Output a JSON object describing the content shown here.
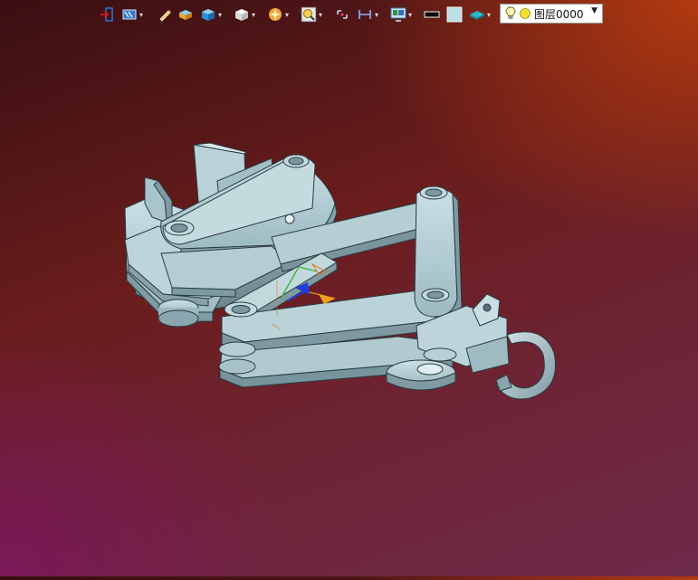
{
  "toolbar": {
    "layer": {
      "name": "图层0000",
      "icons": [
        "lightbulb-icon",
        "sun-icon"
      ]
    },
    "buttons": [
      "exit-icon",
      "film-icon",
      "pencil-icon",
      "box-solid-icon",
      "box-blue-icon",
      "cube-view-icon",
      "star-render-icon",
      "zoom-icon",
      "snap-icon",
      "dimension-icon",
      "display-icon",
      "line-color-icon",
      "fill-color-icon",
      "plane-icon"
    ]
  },
  "colors": {
    "part": "#b7d3d9",
    "part_shadow": "#7d9aa2",
    "part_edge": "#2a3c42",
    "bg_top_right": "#b23a10",
    "bg_bottom_left": "#7a1858"
  }
}
